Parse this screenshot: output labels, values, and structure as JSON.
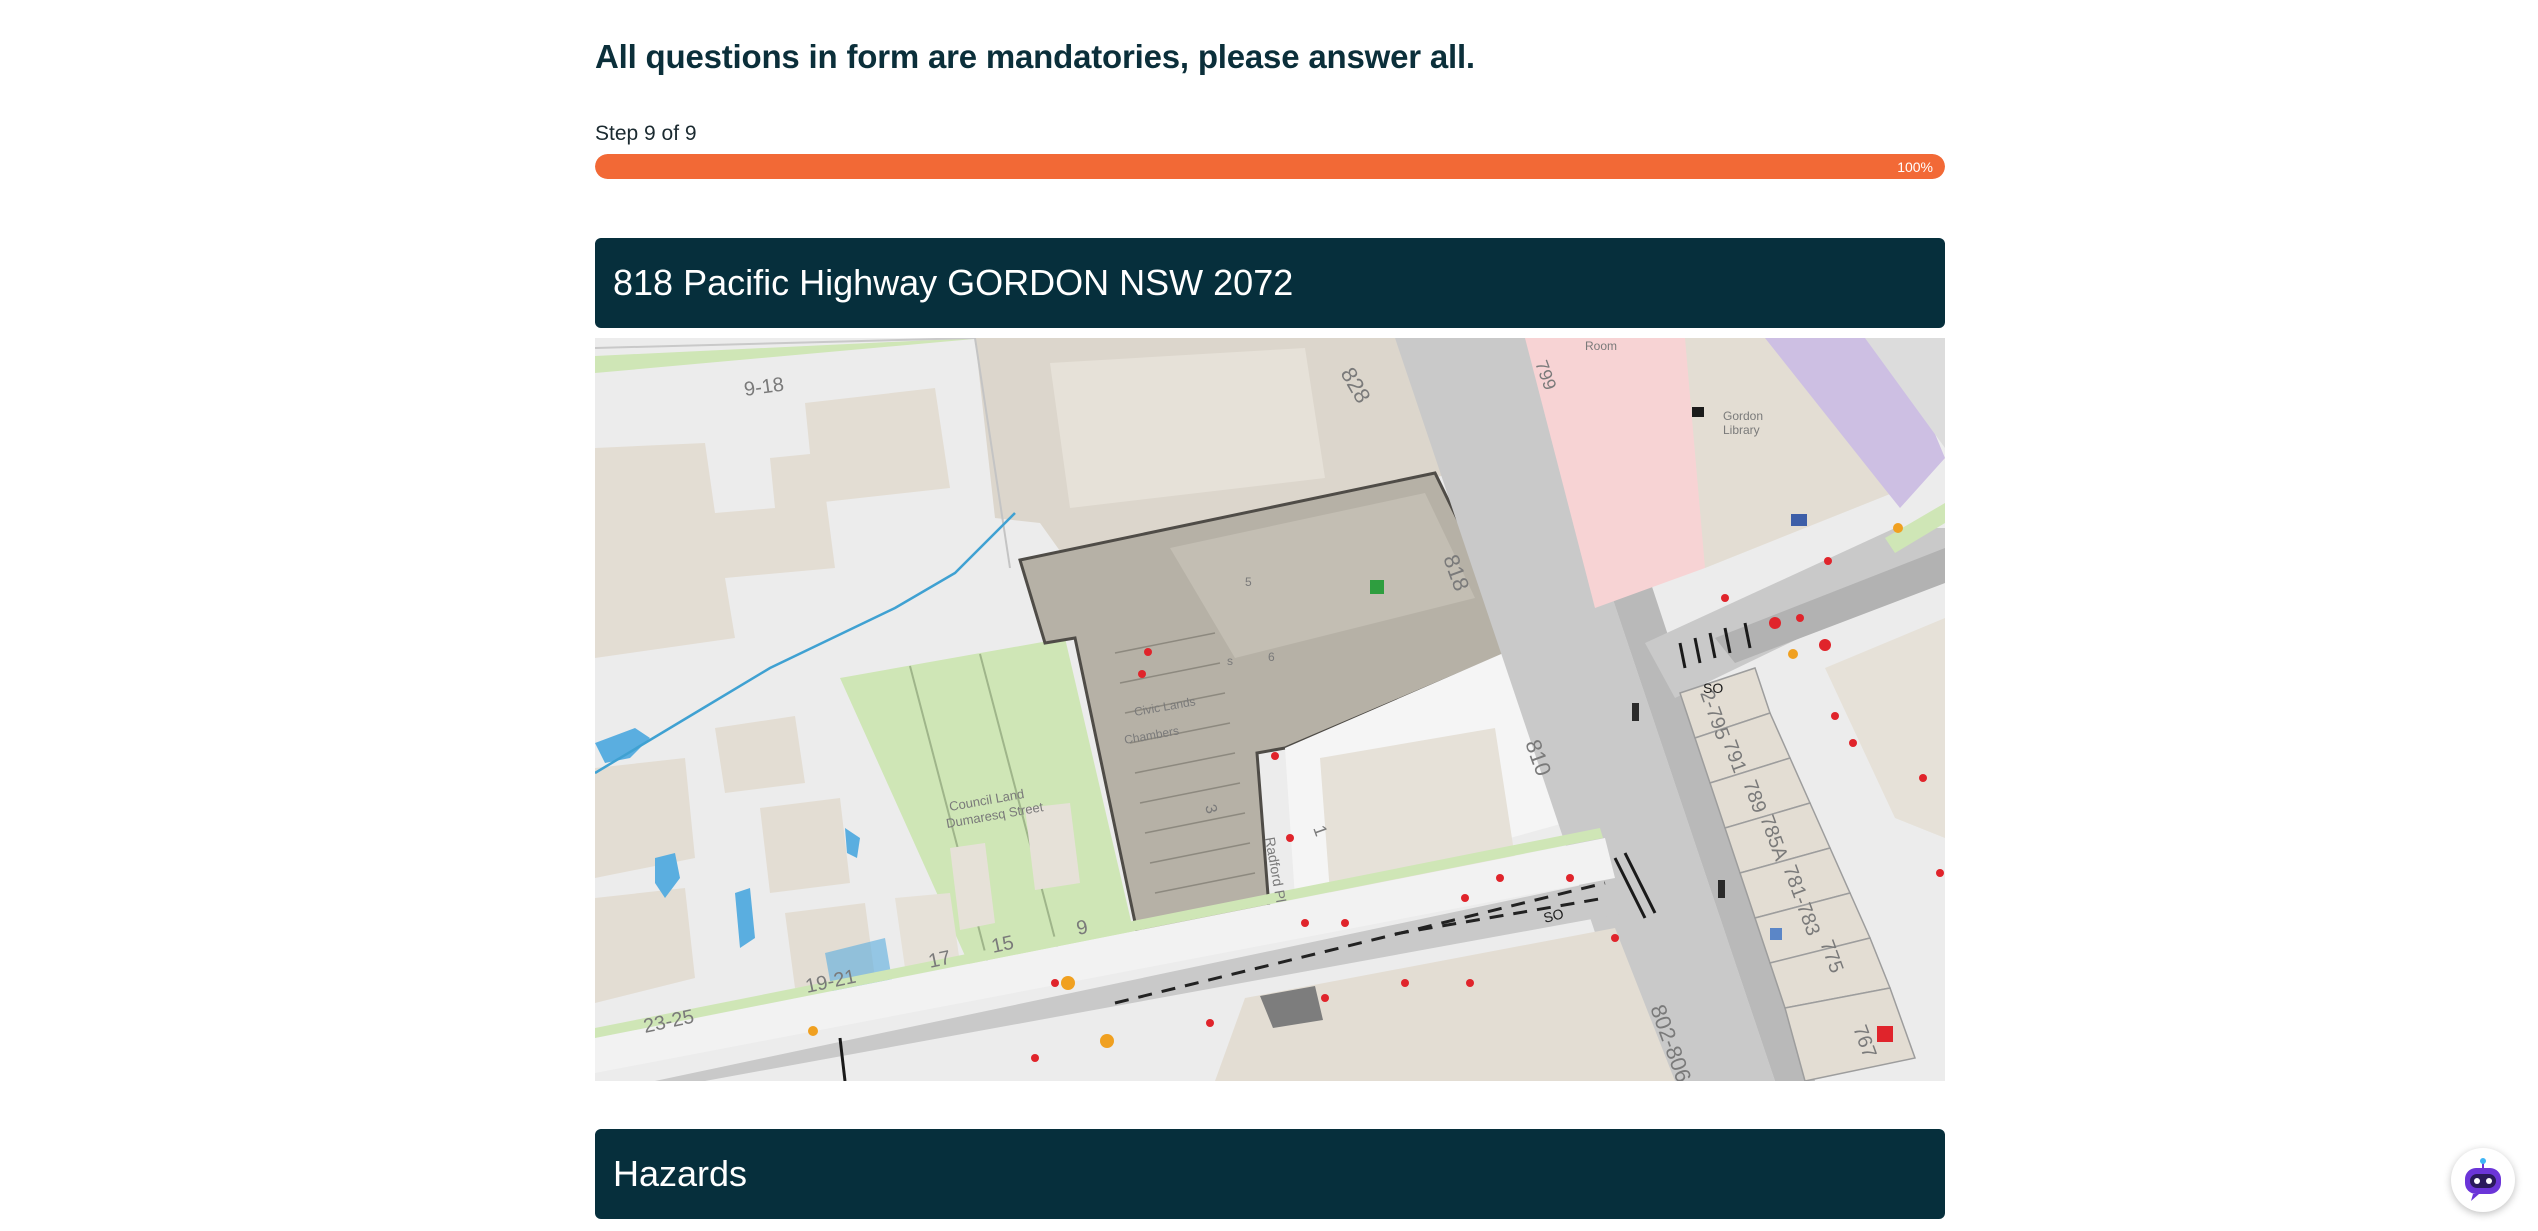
{
  "form": {
    "instructions": "All questions in form are mandatories, please answer all.",
    "step_label": "Step 9 of 9",
    "progress": {
      "percent": 100,
      "text": "100%",
      "color": "#f26936"
    }
  },
  "address_section": {
    "title": "818 Pacific Highway GORDON NSW 2072"
  },
  "map": {
    "lot_labels": [
      "9-18",
      "828",
      "818",
      "810",
      "799",
      "1",
      "17",
      "15",
      "9",
      "19-21",
      "23-25",
      "802-806",
      "767",
      "775",
      "781-783",
      "785A",
      "789",
      "791",
      "2-795",
      "3",
      "5",
      "6",
      "s",
      "SO",
      "SO"
    ],
    "area_labels": [
      "Council Land Dumaresq Street",
      "Civic Lands Chambers",
      "Gordon Library",
      "Room",
      "Radford Pl"
    ]
  },
  "hazards_section": {
    "title": "Hazards"
  },
  "chatbot": {
    "icon": "robot-chat-icon",
    "accent": "#6b35d8"
  },
  "colors": {
    "header_bg": "#062f3c",
    "heading_text": "#0b2f3a"
  }
}
